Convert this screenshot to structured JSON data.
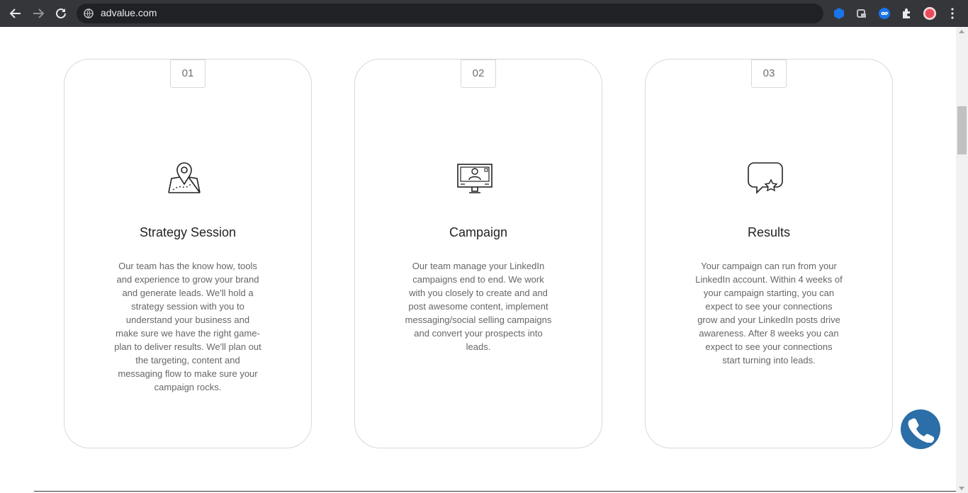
{
  "browser": {
    "url": "advalue.com",
    "nav": {
      "back_icon": "arrow-left-icon",
      "forward_icon": "arrow-right-icon",
      "reload_icon": "reload-icon"
    },
    "extensions": [
      "puzzle-icon",
      "profile-avatar"
    ]
  },
  "cards": [
    {
      "number": "01",
      "icon": "map-pin-icon",
      "title": "Strategy Session",
      "text": "Our team has the know how, tools and experience to grow your brand and generate leads. We'll hold a strategy session with you to understand your business and make sure we have the right game-plan to deliver results. We'll plan out the targeting, content and messaging flow to make sure your campaign rocks."
    },
    {
      "number": "02",
      "icon": "monitor-user-icon",
      "title": "Campaign",
      "text": "Our team manage your LinkedIn campaigns end to end. We work with you closely to create and and post awesome content, implement messaging/social selling campaigns and convert your prospects into leads."
    },
    {
      "number": "03",
      "icon": "chat-star-icon",
      "title": "Results",
      "text": "Your campaign can run from your LinkedIn account. Within 4 weeks of your campaign starting, you can expect to see your connections grow and your LinkedIn posts drive awareness. After 8 weeks you can expect to see your connections start turning into leads."
    }
  ],
  "call_button": {
    "icon": "phone-icon"
  },
  "colors": {
    "accent": "#2b6ea8",
    "chrome": "#35363a",
    "omnibox": "#202124"
  }
}
